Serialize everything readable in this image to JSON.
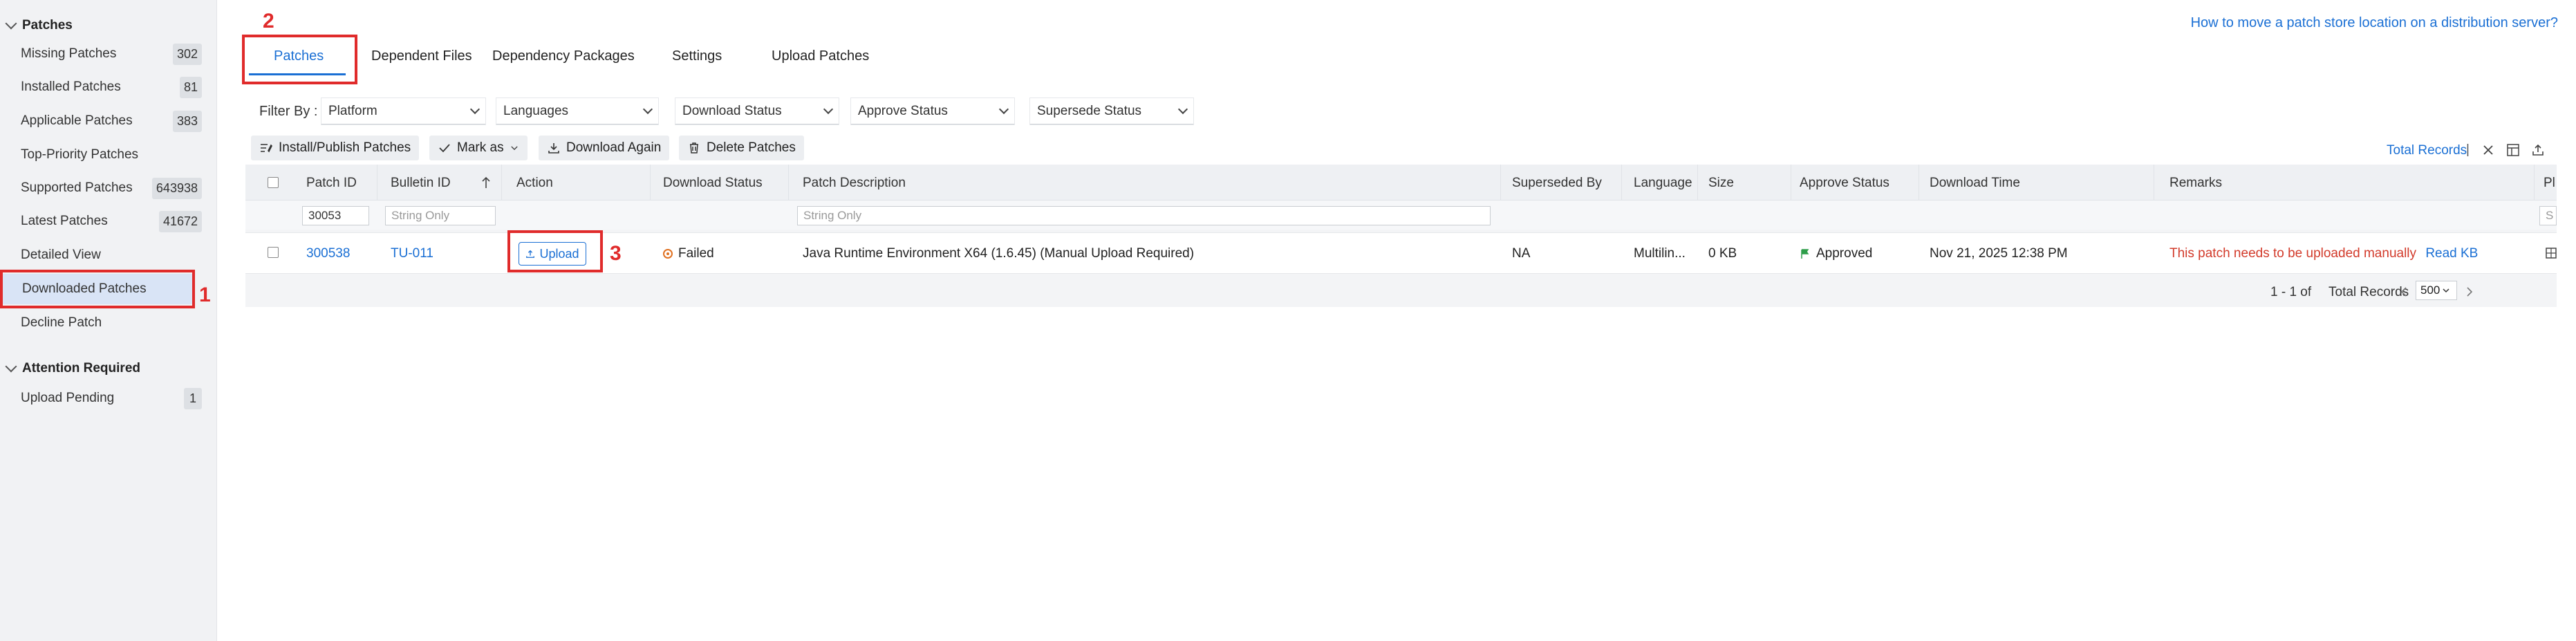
{
  "sidebar": {
    "section1": "Patches",
    "items": [
      {
        "label": "Missing Patches",
        "count": "302"
      },
      {
        "label": "Installed Patches",
        "count": "81"
      },
      {
        "label": "Applicable Patches",
        "count": "383"
      },
      {
        "label": "Top-Priority Patches",
        "count": ""
      },
      {
        "label": "Supported Patches",
        "count": "643938"
      },
      {
        "label": "Latest Patches",
        "count": "41672"
      },
      {
        "label": "Detailed View",
        "count": ""
      },
      {
        "label": "Downloaded Patches",
        "count": ""
      },
      {
        "label": "Decline Patch",
        "count": ""
      }
    ],
    "section2": "Attention Required",
    "items2": [
      {
        "label": "Upload Pending",
        "count": "1"
      }
    ]
  },
  "annotations": {
    "n1": "1",
    "n2": "2",
    "n3": "3"
  },
  "help_link": "How to move a patch store location on a distribution server?",
  "tabs": [
    "Patches",
    "Dependent Files",
    "Dependency Packages",
    "Settings",
    "Upload Patches"
  ],
  "filters": {
    "label": "Filter By :",
    "platform": "Platform",
    "languages": "Languages",
    "download_status": "Download Status",
    "approve_status": "Approve Status",
    "supersede_status": "Supersede Status"
  },
  "toolbar": {
    "install_publish": "Install/Publish Patches",
    "mark_as": "Mark as",
    "download_again": "Download Again",
    "delete_patches": "Delete Patches",
    "total_records": "Total Records",
    "separator": "|"
  },
  "table": {
    "headers": {
      "patch_id": "Patch ID",
      "bulletin_id": "Bulletin ID",
      "action": "Action",
      "download_status": "Download Status",
      "patch_description": "Patch Description",
      "superseded_by": "Superseded By",
      "language": "Language",
      "size": "Size",
      "approve_status": "Approve Status",
      "download_time": "Download Time",
      "remarks": "Remarks",
      "platform": "Pl"
    },
    "filter_values": {
      "patch_id": "30053",
      "bulletin_placeholder": "String Only",
      "description_placeholder": "String Only",
      "platform_placeholder": "S"
    },
    "row": {
      "patch_id": "300538",
      "bulletin_id": "TU-011",
      "action": "Upload",
      "download_status": "Failed",
      "patch_description": "Java Runtime Environment X64 (1.6.45) (Manual Upload Required)",
      "superseded_by": "NA",
      "language": "Multilin...",
      "size": "0 KB",
      "approve_status": "Approved",
      "download_time": "Nov 21, 2025 12:38 PM",
      "remarks": "This patch needs to be uploaded manually",
      "read_kb": "Read KB"
    },
    "pager": {
      "range": "1 - 1 of",
      "total_records": "Total Records",
      "page_size": "500"
    }
  },
  "colors": {
    "accent": "#1a6fd4",
    "annotation": "#e02b2b",
    "failed": "#e07020",
    "approved": "#2e9e4a",
    "remarks": "#d23a2a"
  }
}
